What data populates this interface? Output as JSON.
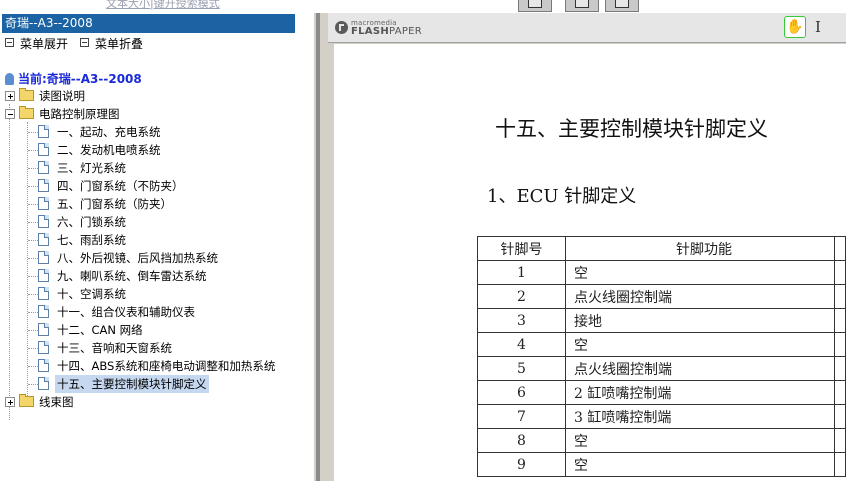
{
  "top_link": "文本大小|键开授索模式",
  "sidebar": {
    "title": "奇瑞--A3--2008",
    "expand_label": "菜单展开",
    "collapse_label": "菜单折叠",
    "current_label": "当前:奇瑞--A3--2008",
    "tree": [
      {
        "label": "读图说明",
        "type": "folder",
        "expanded": false
      },
      {
        "label": "电路控制原理图",
        "type": "folder",
        "expanded": true,
        "children": [
          "一、起动、充电系统",
          "二、发动机电喷系统",
          "三、灯光系统",
          "四、门窗系统（不防夹）",
          "五、门窗系统（防夹）",
          "六、门锁系统",
          "七、雨刮系统",
          "八、外后视镜、后风挡加热系统",
          "九、喇叭系统、倒车雷达系统",
          "十、空调系统",
          "十一、组合仪表和辅助仪表",
          "十二、CAN 网络",
          "十三、音响和天窗系统",
          "十四、ABS系统和座椅电动调整和加热系统",
          "十五、主要控制模块针脚定义"
        ],
        "selected_index": 14
      },
      {
        "label": "线束图",
        "type": "folder",
        "expanded": false
      }
    ]
  },
  "viewer": {
    "brand_small": "macromedia",
    "brand_name": "FLASH",
    "brand_name2": "PAPER",
    "hand_tool_icon": "hand-icon",
    "text_tool_icon": "text-cursor-icon"
  },
  "document": {
    "title": "十五、主要控制模块针脚定义",
    "subtitle": "1、ECU 针脚定义",
    "table": {
      "headers": [
        "针脚号",
        "针脚功能"
      ],
      "rows": [
        [
          "1",
          "空"
        ],
        [
          "2",
          "点火线圈控制端"
        ],
        [
          "3",
          "接地"
        ],
        [
          "4",
          "空"
        ],
        [
          "5",
          "点火线圈控制端"
        ],
        [
          "6",
          "2 缸喷嘴控制端"
        ],
        [
          "7",
          "3 缸喷嘴控制端"
        ],
        [
          "8",
          "空"
        ],
        [
          "9",
          "空"
        ]
      ]
    }
  },
  "colors": {
    "sidebar_title_bg": "#1c63a3",
    "current_text": "#1a2ad8",
    "selection_bg": "#c6d8ef"
  }
}
